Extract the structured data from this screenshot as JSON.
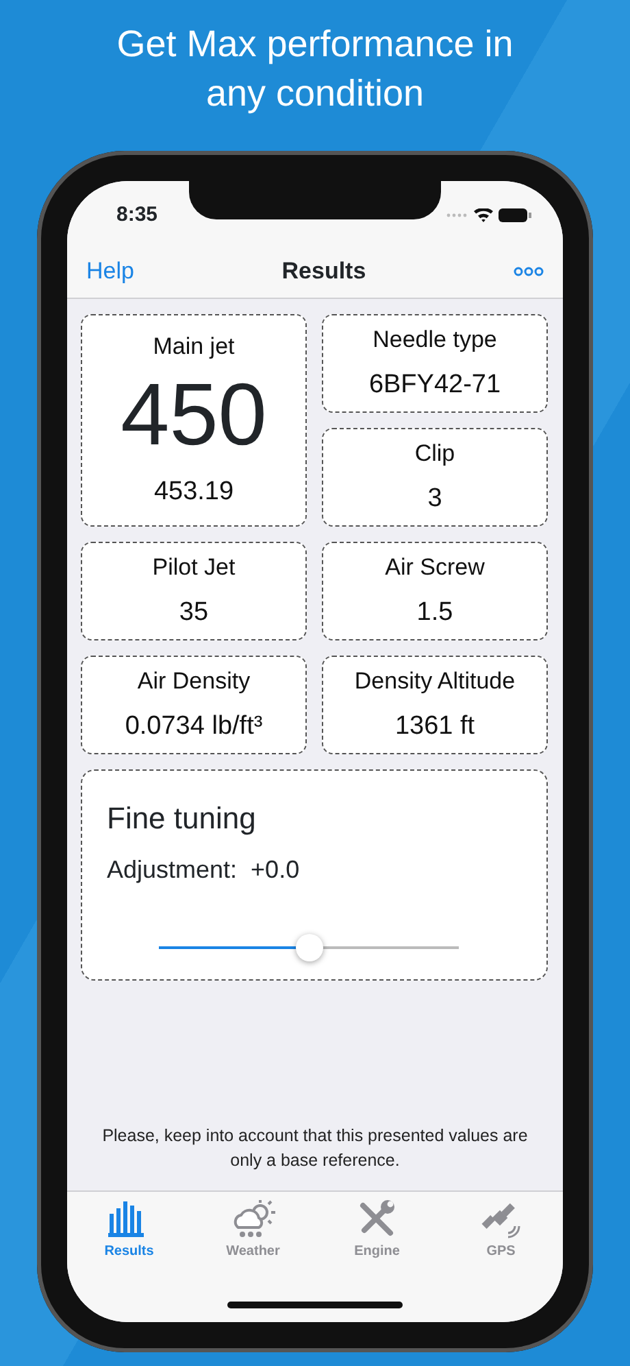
{
  "headline": "Get Max performance in any condition",
  "status_bar": {
    "time": "8:35"
  },
  "nav": {
    "left": "Help",
    "title": "Results"
  },
  "main_jet": {
    "label": "Main jet",
    "value": "450",
    "precise": "453.19"
  },
  "cards": [
    {
      "label": "Needle type",
      "value": "6BFY42-71"
    },
    {
      "label": "Clip",
      "value": "3"
    },
    {
      "label": "Pilot Jet",
      "value": "35"
    },
    {
      "label": "Air Screw",
      "value": "1.5"
    },
    {
      "label": "Air Density",
      "value": "0.0734 lb/ft³"
    },
    {
      "label": "Density Altitude",
      "value": "1361 ft"
    }
  ],
  "fine_tuning": {
    "title": "Fine tuning",
    "label": "Adjustment:",
    "value": "+0.0",
    "level": 0.5
  },
  "note": "Please, keep into account that this presented values are only a base reference.",
  "tabs": [
    {
      "label": "Results",
      "selected": true
    },
    {
      "label": "Weather",
      "selected": false
    },
    {
      "label": "Engine",
      "selected": false
    },
    {
      "label": "GPS",
      "selected": false
    }
  ]
}
